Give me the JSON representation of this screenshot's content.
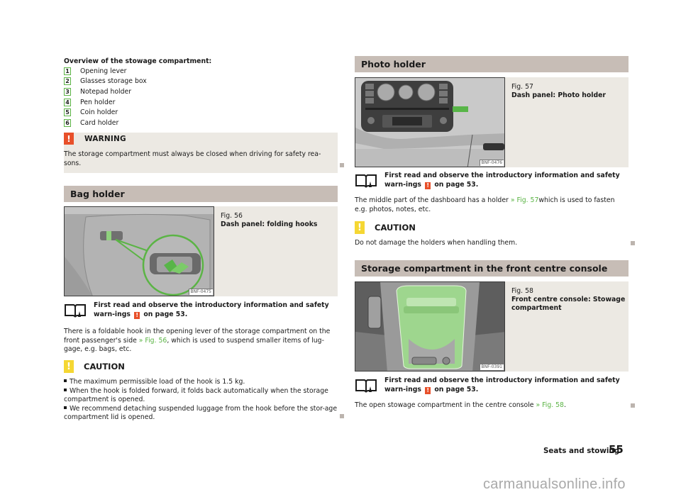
{
  "overview": {
    "title": "Overview of the stowage compartment:",
    "items": [
      {
        "num": "1",
        "label": "Opening lever"
      },
      {
        "num": "2",
        "label": "Glasses storage box"
      },
      {
        "num": "3",
        "label": "Notepad holder"
      },
      {
        "num": "4",
        "label": "Pen holder"
      },
      {
        "num": "5",
        "label": "Coin holder"
      },
      {
        "num": "6",
        "label": "Card holder"
      }
    ]
  },
  "warning": {
    "icon": "warning-exclamation-icon",
    "title": "WARNING",
    "text": "The storage compartment must always be closed when driving for safety rea-sons."
  },
  "bag_holder": {
    "heading": "Bag holder",
    "figure": {
      "number": "Fig. 56",
      "title": "Dash panel: folding hooks",
      "code": "BNF-0475"
    },
    "note": {
      "prefix": "First read and observe the introductory information and safety warn-ings",
      "suffix": "on page 53."
    },
    "body": {
      "pre": "There is a foldable hook in the opening lever of the storage compartment on the front passenger's side ",
      "link": "» Fig. 56",
      "post": ", which is used to suspend smaller items of lug-gage, e.g. bags, etc."
    },
    "caution": {
      "title": "CAUTION",
      "bullets": [
        "The maximum permissible load of the hook is 1.5 kg.",
        "When the hook is folded forward, it folds back automatically when the storage compartment is opened.",
        "We recommend detaching suspended luggage from the hook before the stor-age compartment lid is opened."
      ]
    }
  },
  "photo_holder": {
    "heading": "Photo holder",
    "figure": {
      "number": "Fig. 57",
      "title": "Dash panel: Photo holder",
      "code": "BNF-0476"
    },
    "note": {
      "prefix": "First read and observe the introductory information and safety warn-ings",
      "suffix": "on page 53."
    },
    "body": {
      "pre": "The middle part of the dashboard has a holder ",
      "link": "» Fig. 57",
      "post": "which is used to fasten e.g. photos, notes, etc."
    },
    "caution": {
      "title": "CAUTION",
      "text": "Do not damage the holders when handling them."
    }
  },
  "centre_console": {
    "heading": "Storage compartment in the front centre console",
    "figure": {
      "number": "Fig. 58",
      "title": "Front centre console: Stowage compartment",
      "code": "BNF-0391"
    },
    "note": {
      "prefix": "First read and observe the introductory information and safety warn-ings",
      "suffix": "on page 53."
    },
    "body": {
      "pre": "The open stowage compartment in the centre console ",
      "link": "» Fig. 58",
      "post": "."
    }
  },
  "footer": {
    "section": "Seats and stowing",
    "page": "55"
  },
  "watermark": "carmanualsonline.info",
  "colors": {
    "accent_green": "#5bb445",
    "warning_red": "#e8502a",
    "caution_yellow": "#f5d733",
    "header_bg": "#c7bdb6",
    "box_bg": "#ece9e3"
  }
}
